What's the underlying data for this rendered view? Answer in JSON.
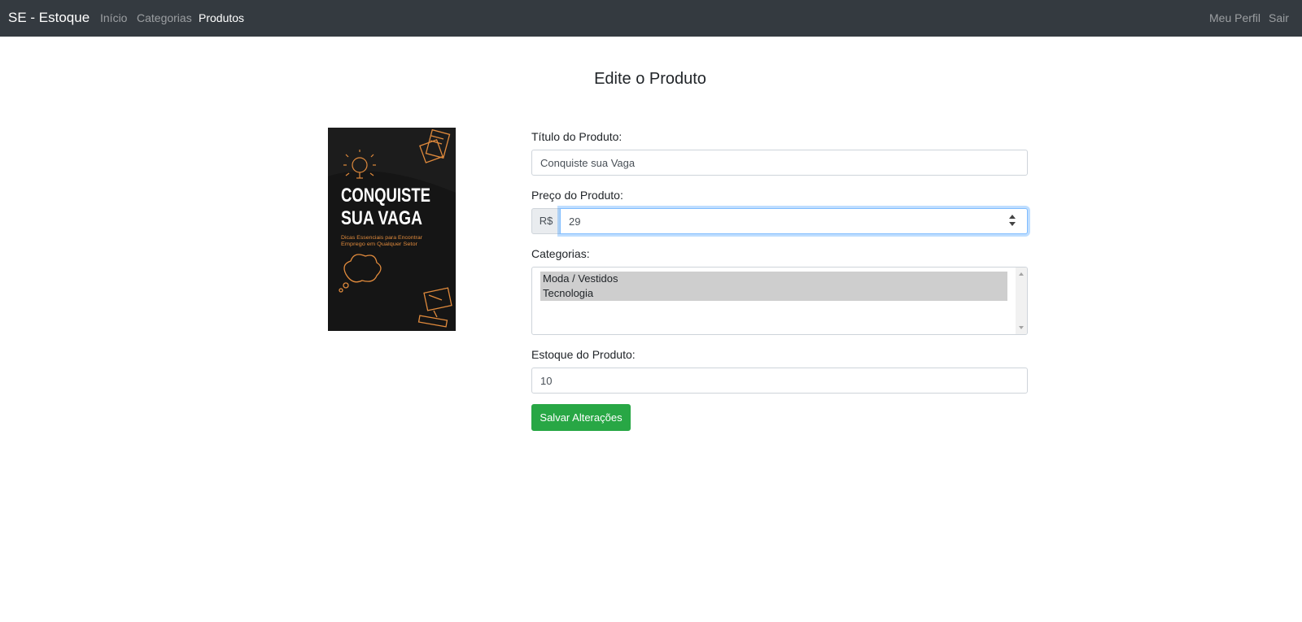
{
  "navbar": {
    "brand": "SE - Estoque",
    "links": [
      {
        "label": "Início",
        "active": false
      },
      {
        "label": "Categorias",
        "active": false
      },
      {
        "label": "Produtos",
        "active": true
      }
    ],
    "right_links": [
      {
        "label": "Meu Perfil"
      },
      {
        "label": "Sair"
      }
    ]
  },
  "page": {
    "title": "Edite o Produto"
  },
  "product_image": {
    "title_line1": "CONQUISTE",
    "title_line2": "SUA VAGA",
    "subtitle_line1": "Dicas Essenciais para Encontrar",
    "subtitle_line2": "Emprego em Qualquer Setor",
    "accent_color": "#e08a3c"
  },
  "form": {
    "title_label": "Título do Produto:",
    "title_value": "Conquiste sua Vaga",
    "price_label": "Preço do Produto:",
    "currency_prefix": "R$",
    "price_value": "29",
    "categories_label": "Categorias:",
    "categories_options": [
      "Moda / Vestidos",
      "Tecnologia"
    ],
    "stock_label": "Estoque do Produto:",
    "stock_value": "10",
    "submit_label": "Salvar Alterações"
  },
  "colors": {
    "navbar_bg": "#343a40",
    "primary_green": "#28a745",
    "focus_blue": "#80bdff"
  }
}
